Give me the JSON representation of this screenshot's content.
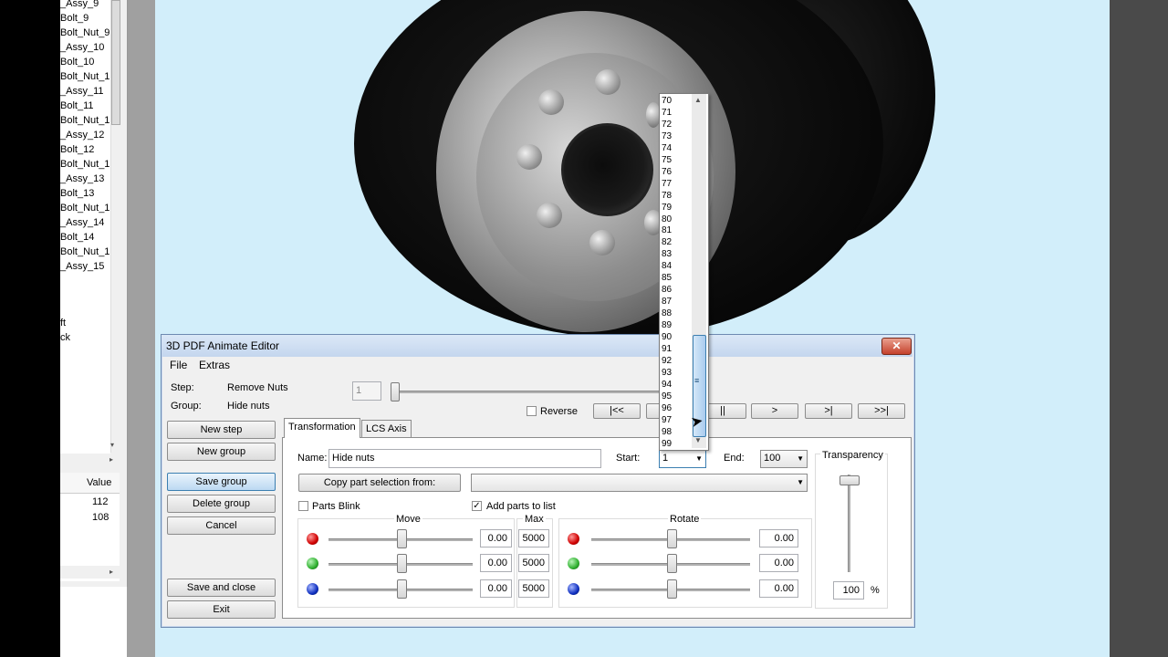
{
  "tree": {
    "items": [
      "_Assy_9",
      "Bolt_9",
      "Bolt_Nut_9",
      "_Assy_10",
      "Bolt_10",
      "Bolt_Nut_1",
      "_Assy_11",
      "Bolt_11",
      "Bolt_Nut_1",
      "_Assy_12",
      "Bolt_12",
      "Bolt_Nut_1",
      "_Assy_13",
      "Bolt_13",
      "Bolt_Nut_1",
      "_Assy_14",
      "Bolt_14",
      "Bolt_Nut_1",
      "_Assy_15"
    ],
    "extra_items": [
      "ft",
      "ck"
    ],
    "value_header": "Value",
    "values": [
      "112",
      "108"
    ]
  },
  "dialog": {
    "title": "3D PDF Animate Editor",
    "close_label": "✕",
    "menu": [
      "File",
      "Extras"
    ],
    "step_label": "Step:",
    "step_value": "Remove Nuts",
    "group_label": "Group:",
    "group_value": "Hide nuts",
    "step_number": "1",
    "reverse_label": "Reverse",
    "nav": [
      "|<<",
      "<<",
      "||",
      ">",
      ">|",
      ">>|"
    ],
    "buttons": {
      "new_step": "New step",
      "new_group": "New group",
      "save_group": "Save group",
      "delete_group": "Delete group",
      "cancel": "Cancel",
      "save_close": "Save and close",
      "exit": "Exit"
    },
    "tabs": [
      "Transformation",
      "LCS Axis"
    ],
    "name_label": "Name:",
    "name_value": "Hide nuts",
    "start_label": "Start:",
    "start_value": "1",
    "end_label": "End:",
    "end_value": "100",
    "copy_button": "Copy part selection from:",
    "parts_blink": "Parts Blink",
    "add_parts": "Add parts to list",
    "move_label": "Move",
    "max_label": "Max",
    "rotate_label": "Rotate",
    "move_values": [
      "0.00",
      "0.00",
      "0.00"
    ],
    "max_values": [
      "5000",
      "5000",
      "5000"
    ],
    "rotate_values": [
      "0.00",
      "0.00",
      "0.00"
    ],
    "transparency_label": "Transparency",
    "transparency_value": "100",
    "percent": "%"
  },
  "dropdown": {
    "items": [
      "70",
      "71",
      "72",
      "73",
      "74",
      "75",
      "76",
      "77",
      "78",
      "79",
      "80",
      "81",
      "82",
      "83",
      "84",
      "85",
      "86",
      "87",
      "88",
      "89",
      "90",
      "91",
      "92",
      "93",
      "94",
      "95",
      "96",
      "97",
      "98",
      "99"
    ]
  },
  "colors": {
    "viewport_bg": "#d2eefa",
    "red_ball": "#d00000",
    "green_ball": "#30b030",
    "blue_ball": "#1030c0"
  }
}
